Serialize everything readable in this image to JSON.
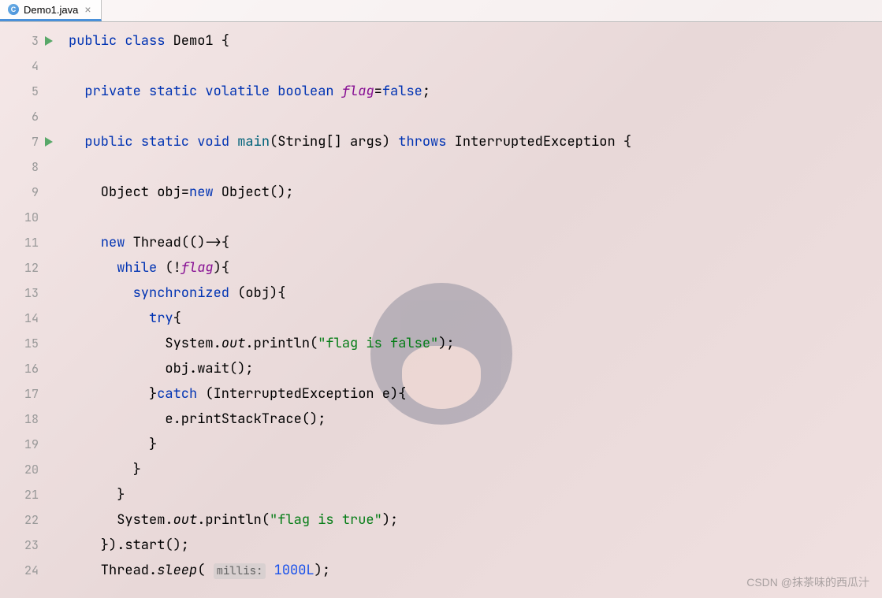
{
  "tab": {
    "filename": "Demo1.java",
    "icon_letter": "C"
  },
  "gutter": {
    "start": 3,
    "end": 24,
    "run_markers": [
      3,
      7
    ]
  },
  "code": {
    "lines": [
      {
        "n": 3,
        "tokens": [
          [
            "kw",
            "public"
          ],
          [
            "",
            " "
          ],
          [
            "kw",
            "class"
          ],
          [
            "",
            " Demo1 {"
          ]
        ]
      },
      {
        "n": 4,
        "tokens": [
          [
            "",
            ""
          ]
        ]
      },
      {
        "n": 5,
        "tokens": [
          [
            "",
            "  "
          ],
          [
            "kw",
            "private"
          ],
          [
            "",
            " "
          ],
          [
            "kw",
            "static"
          ],
          [
            "",
            " "
          ],
          [
            "kw",
            "volatile"
          ],
          [
            "",
            " "
          ],
          [
            "kw",
            "boolean"
          ],
          [
            "",
            " "
          ],
          [
            "field-italic",
            "flag"
          ],
          [
            "",
            "="
          ],
          [
            "kw",
            "false"
          ],
          [
            "",
            ";"
          ]
        ]
      },
      {
        "n": 6,
        "tokens": [
          [
            "",
            ""
          ]
        ]
      },
      {
        "n": 7,
        "tokens": [
          [
            "",
            "  "
          ],
          [
            "kw",
            "public"
          ],
          [
            "",
            " "
          ],
          [
            "kw",
            "static"
          ],
          [
            "",
            " "
          ],
          [
            "kw",
            "void"
          ],
          [
            "",
            " "
          ],
          [
            "method",
            "main"
          ],
          [
            "",
            "(String[] args) "
          ],
          [
            "kw",
            "throws"
          ],
          [
            "",
            " InterruptedException {"
          ]
        ]
      },
      {
        "n": 8,
        "tokens": [
          [
            "",
            ""
          ]
        ]
      },
      {
        "n": 9,
        "tokens": [
          [
            "",
            "    Object obj="
          ],
          [
            "kw",
            "new"
          ],
          [
            "",
            " Object();"
          ]
        ]
      },
      {
        "n": 10,
        "tokens": [
          [
            "",
            ""
          ]
        ]
      },
      {
        "n": 11,
        "tokens": [
          [
            "",
            "    "
          ],
          [
            "kw",
            "new"
          ],
          [
            "",
            " Thread(()->{"
          ]
        ]
      },
      {
        "n": 12,
        "tokens": [
          [
            "",
            "      "
          ],
          [
            "kw",
            "while"
          ],
          [
            "",
            " (!"
          ],
          [
            "field-italic",
            "flag"
          ],
          [
            "",
            ")"
          ],
          [
            "",
            "{"
          ]
        ]
      },
      {
        "n": 13,
        "tokens": [
          [
            "",
            "        "
          ],
          [
            "kw",
            "synchronized"
          ],
          [
            "",
            " ("
          ],
          [
            "",
            "obj"
          ],
          [
            "",
            ")"
          ],
          [
            "",
            "{"
          ]
        ]
      },
      {
        "n": 14,
        "tokens": [
          [
            "",
            "          "
          ],
          [
            "kw",
            "try"
          ],
          [
            "",
            "{"
          ]
        ]
      },
      {
        "n": 15,
        "tokens": [
          [
            "",
            "            System."
          ],
          [
            "static-italic",
            "out"
          ],
          [
            "",
            ".println("
          ],
          [
            "str",
            "\"flag is false\""
          ],
          [
            "",
            ");"
          ]
        ]
      },
      {
        "n": 16,
        "tokens": [
          [
            "",
            "            "
          ],
          [
            "",
            "obj"
          ],
          [
            "",
            ".wait();"
          ]
        ]
      },
      {
        "n": 17,
        "tokens": [
          [
            "",
            "          }"
          ],
          [
            "kw",
            "catch"
          ],
          [
            "",
            " (InterruptedException e){"
          ]
        ]
      },
      {
        "n": 18,
        "tokens": [
          [
            "",
            "            e.printStackTrace();"
          ]
        ]
      },
      {
        "n": 19,
        "tokens": [
          [
            "",
            "          }"
          ]
        ]
      },
      {
        "n": 20,
        "tokens": [
          [
            "",
            "        }"
          ]
        ]
      },
      {
        "n": 21,
        "tokens": [
          [
            "",
            "      }"
          ]
        ]
      },
      {
        "n": 22,
        "tokens": [
          [
            "",
            "      System."
          ],
          [
            "static-italic",
            "out"
          ],
          [
            "",
            ".println("
          ],
          [
            "str",
            "\"flag is true\""
          ],
          [
            "",
            ");"
          ]
        ]
      },
      {
        "n": 23,
        "tokens": [
          [
            "",
            "    }).start();"
          ]
        ]
      },
      {
        "n": 24,
        "tokens": [
          [
            "",
            "    Thread."
          ],
          [
            "static-italic",
            "sleep"
          ],
          [
            "",
            "( "
          ],
          [
            "param-hint",
            "millis:"
          ],
          [
            "",
            " "
          ],
          [
            "num",
            "1000L"
          ],
          [
            "",
            ");"
          ]
        ]
      }
    ]
  },
  "watermark": "CSDN @抹茶味的西瓜汁"
}
